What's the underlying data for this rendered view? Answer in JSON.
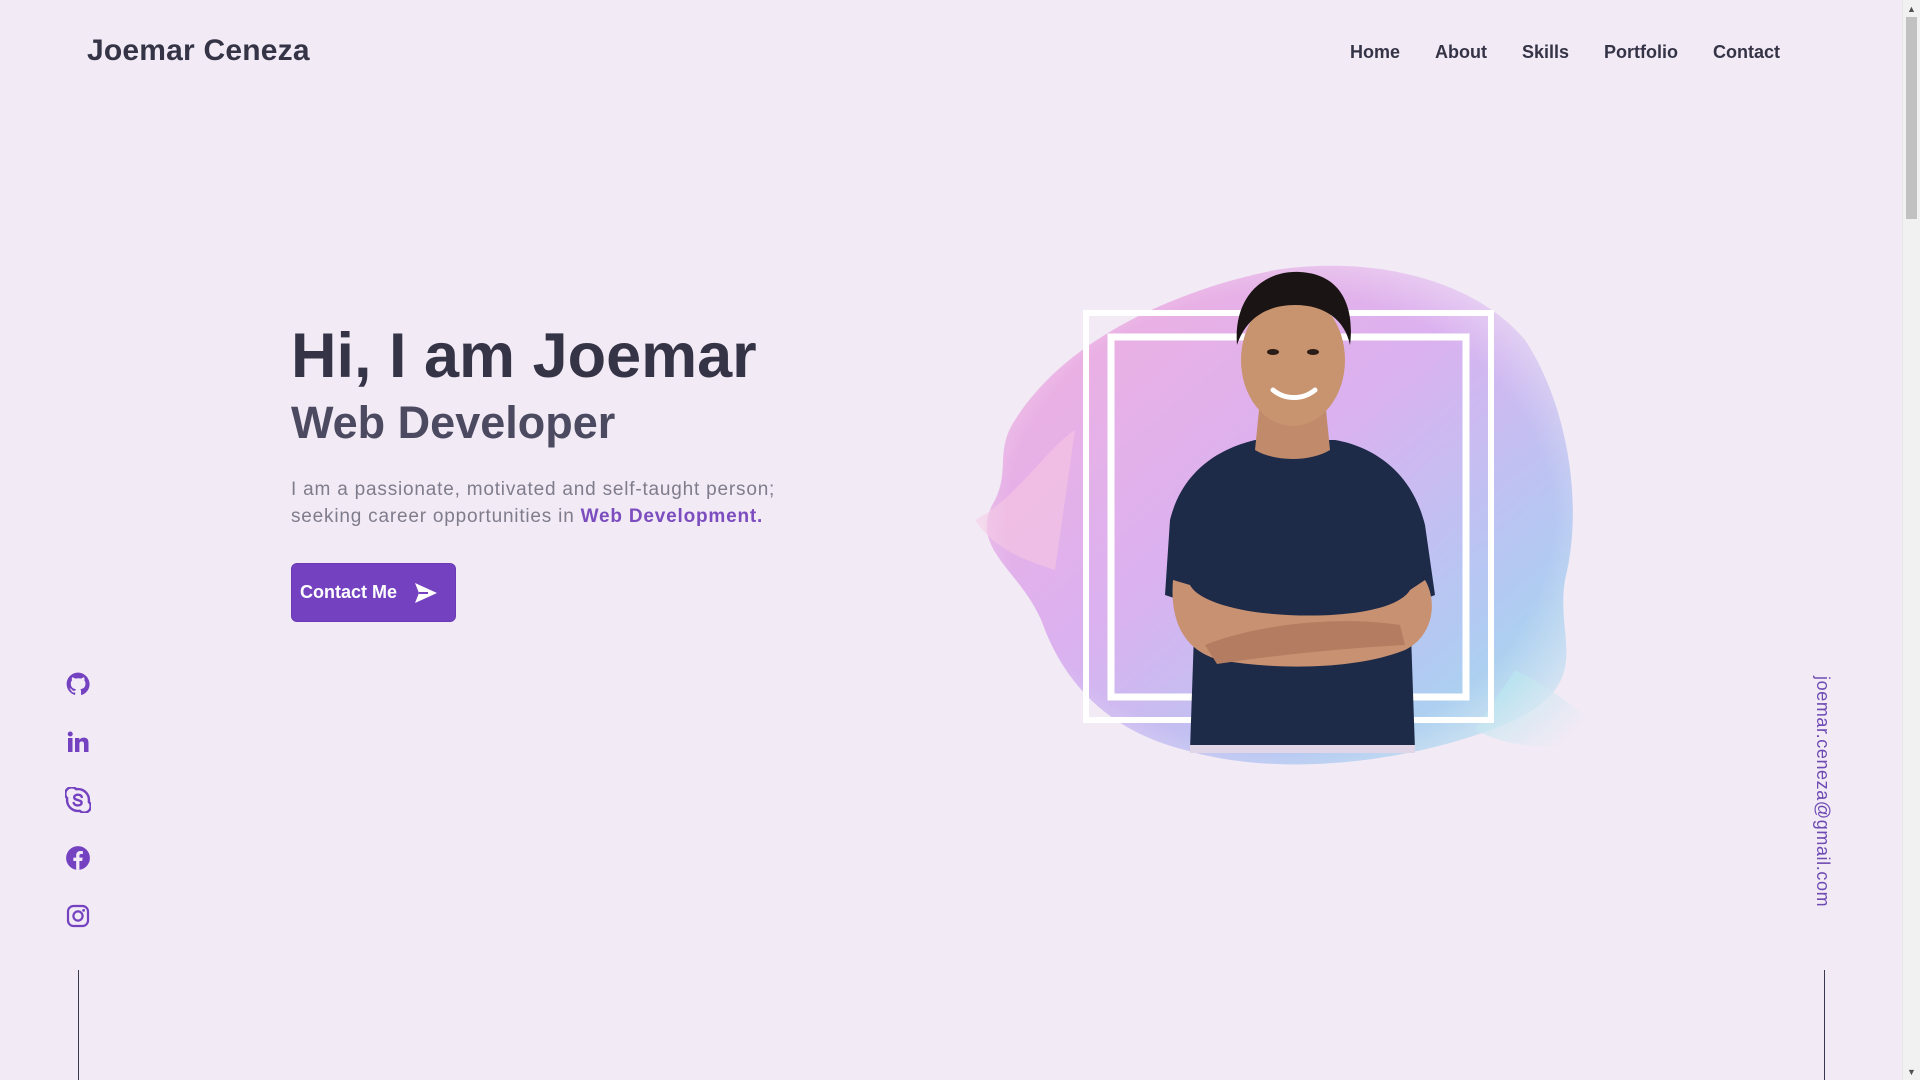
{
  "header": {
    "logo": "Joemar Ceneza",
    "nav": [
      "Home",
      "About",
      "Skills",
      "Portfolio",
      "Contact"
    ]
  },
  "hero": {
    "title": "Hi, I am Joemar",
    "subtitle": "Web Developer",
    "desc_line1": "I am a passionate, motivated and self-taught person;",
    "desc_line2_prefix": "seeking career opportunities in ",
    "desc_highlight": "Web Development.",
    "button_label": "Contact Me"
  },
  "social_icons": [
    "github-icon",
    "linkedin-icon",
    "skype-icon",
    "facebook-icon",
    "instagram-icon"
  ],
  "email": "joemar.ceneza@gmail.com",
  "colors": {
    "background": "#f2eaf5",
    "accent": "#7442c0",
    "text_dark": "#353447",
    "text_muted": "#7f7c8c"
  }
}
